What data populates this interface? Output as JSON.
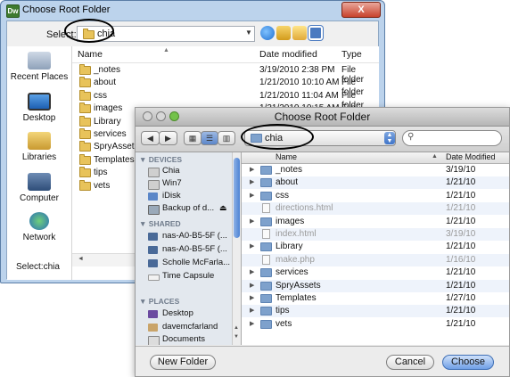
{
  "windows_dialog": {
    "title": "Choose Root Folder",
    "app_icon": "Dw",
    "close_label": "X",
    "select_label": "Select:",
    "select_value": "chia",
    "columns": [
      "Name",
      "Date modified",
      "Type"
    ],
    "places": [
      "Recent Places",
      "Desktop",
      "Libraries",
      "Computer",
      "Network"
    ],
    "rows": [
      {
        "name": "_notes",
        "date": "3/19/2010 2:38 PM",
        "type": "File folder"
      },
      {
        "name": "about",
        "date": "1/21/2010 10:10 AM",
        "type": "File folder"
      },
      {
        "name": "css",
        "date": "1/21/2010 11:04 AM",
        "type": "File folder"
      },
      {
        "name": "images",
        "date": "1/21/2010 10:15 AM",
        "type": "File folder"
      },
      {
        "name": "Library",
        "date": "",
        "type": ""
      },
      {
        "name": "services",
        "date": "",
        "type": ""
      },
      {
        "name": "SpryAssets",
        "date": "",
        "type": ""
      },
      {
        "name": "Templates",
        "date": "",
        "type": ""
      },
      {
        "name": "tips",
        "date": "",
        "type": ""
      },
      {
        "name": "vets",
        "date": "",
        "type": ""
      }
    ],
    "status": "Select:chia"
  },
  "mac_dialog": {
    "title": "Choose Root Folder",
    "path_value": "chia",
    "sidebar": {
      "devices_header": "DEVICES",
      "devices": [
        "Chia",
        "Win7",
        "iDisk",
        "Backup of d..."
      ],
      "shared_header": "SHARED",
      "shared": [
        "nas-A0-B5-5F (...",
        "nas-A0-B5-5F (...",
        "Scholle McFarla...",
        "Time Capsule"
      ],
      "places_header": "PLACES",
      "places": [
        "Desktop",
        "davemcfarland",
        "Documents"
      ]
    },
    "columns": [
      "Name",
      "Date Modified"
    ],
    "rows": [
      {
        "name": "_notes",
        "date": "3/19/10",
        "kind": "folder"
      },
      {
        "name": "about",
        "date": "1/21/10",
        "kind": "folder"
      },
      {
        "name": "css",
        "date": "1/21/10",
        "kind": "folder"
      },
      {
        "name": "directions.html",
        "date": "1/21/10",
        "kind": "file"
      },
      {
        "name": "images",
        "date": "1/21/10",
        "kind": "folder"
      },
      {
        "name": "index.html",
        "date": "3/19/10",
        "kind": "file"
      },
      {
        "name": "Library",
        "date": "1/21/10",
        "kind": "folder"
      },
      {
        "name": "make.php",
        "date": "1/16/10",
        "kind": "file"
      },
      {
        "name": "services",
        "date": "1/21/10",
        "kind": "folder"
      },
      {
        "name": "SpryAssets",
        "date": "1/21/10",
        "kind": "folder"
      },
      {
        "name": "Templates",
        "date": "1/27/10",
        "kind": "folder"
      },
      {
        "name": "tips",
        "date": "1/21/10",
        "kind": "folder"
      },
      {
        "name": "vets",
        "date": "1/21/10",
        "kind": "folder"
      }
    ],
    "new_folder_label": "New Folder",
    "cancel_label": "Cancel",
    "choose_label": "Choose"
  },
  "colors": {
    "mac_accent": "#4d83d4",
    "win_frame": "#bcd3ec",
    "win_close": "#c8422b"
  }
}
